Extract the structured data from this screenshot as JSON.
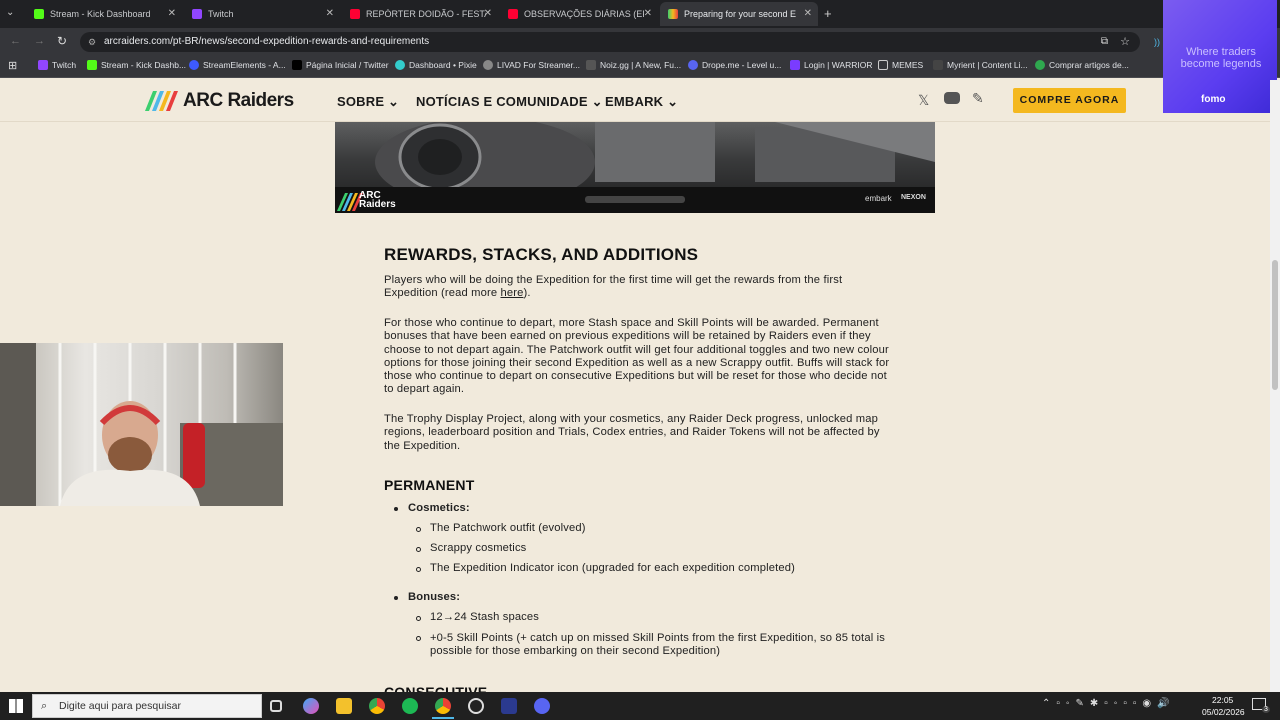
{
  "browser": {
    "tabs": [
      {
        "label": "Stream - Kick Dashboard",
        "color": "#53fc18"
      },
      {
        "label": "Twitch",
        "color": "#9146ff"
      },
      {
        "label": "REPÓRTER DOIDÃO - FESTA DA",
        "color": "#ff0033"
      },
      {
        "label": "OBSERVAÇÕES DIÁRIAS (EP. 30",
        "color": "#ff0033"
      },
      {
        "label": "Preparing for your second Expe",
        "color": "#f4b81f"
      }
    ],
    "url": "arcraiders.com/pt-BR/news/second-expedition-rewards-and-requirements",
    "bookmarks": [
      "Twitch",
      "Stream - Kick Dashb...",
      "StreamElements - A...",
      "Página Inicial / Twitter",
      "Dashboard • Pixie",
      "LIVAD For Streamer...",
      "Noiz.gg | A New, Fu...",
      "Drope.me - Level u...",
      "Login | WARRIOR",
      "MEMES",
      "Myrient | Content Li...",
      "Comprar artigos de..."
    ]
  },
  "site": {
    "logo": "ARC Raiders",
    "nav": [
      "SOBRE",
      "NOTÍCIAS E COMUNIDADE",
      "EMBARK"
    ],
    "buy_label": "COMPRE AGORA",
    "banner_logo": "ARC Raiders",
    "banner_brands": [
      "embark",
      "NEXON"
    ]
  },
  "ad": {
    "line1": "Where traders",
    "line2": "become legends",
    "brand": "fomo"
  },
  "article": {
    "heading1": "REWARDS, STACKS, AND ADDITIONS",
    "p1_before": "Players who will be doing the Expedition for the first time will get the rewards from the first Expedition (read more ",
    "p1_link": "here",
    "p1_after": ").",
    "p2": "For those who continue to depart, more Stash space and Skill Points will be awarded. Permanent bonuses that have been earned on previous expeditions will be retained by Raiders even if they choose to not depart again. The Patchwork outfit will get four additional toggles and two new colour options for those joining their second Expedition as well as a new Scrappy outfit. Buffs will stack for those who continue to depart on consecutive Expeditions but will be reset for those who decide not to depart again.",
    "p3": "The Trophy Display Project, along with your cosmetics, any Raider Deck progress, unlocked map regions, leaderboard position and Trials, Codex entries, and Raider Tokens will not be affected by the Expedition.",
    "heading2": "PERMANENT",
    "cosmetics_label": "Cosmetics:",
    "cosmetics": [
      "The Patchwork outfit (evolved)",
      "Scrappy cosmetics",
      "The Expedition Indicator icon (upgraded for each expedition completed)"
    ],
    "bonuses_label": "Bonuses:",
    "bonuses": [
      "12→24 Stash spaces",
      "+0-5 Skill Points (+ catch up on missed Skill Points from the first Expedition, so 85 total is possible for those embarking on their second Expedition)"
    ],
    "heading3": "CONSECUTIVE"
  },
  "taskbar": {
    "search_placeholder": "Digite aqui para pesquisar",
    "time": "22:05",
    "date": "05/02/2026",
    "notif_count": "3"
  }
}
